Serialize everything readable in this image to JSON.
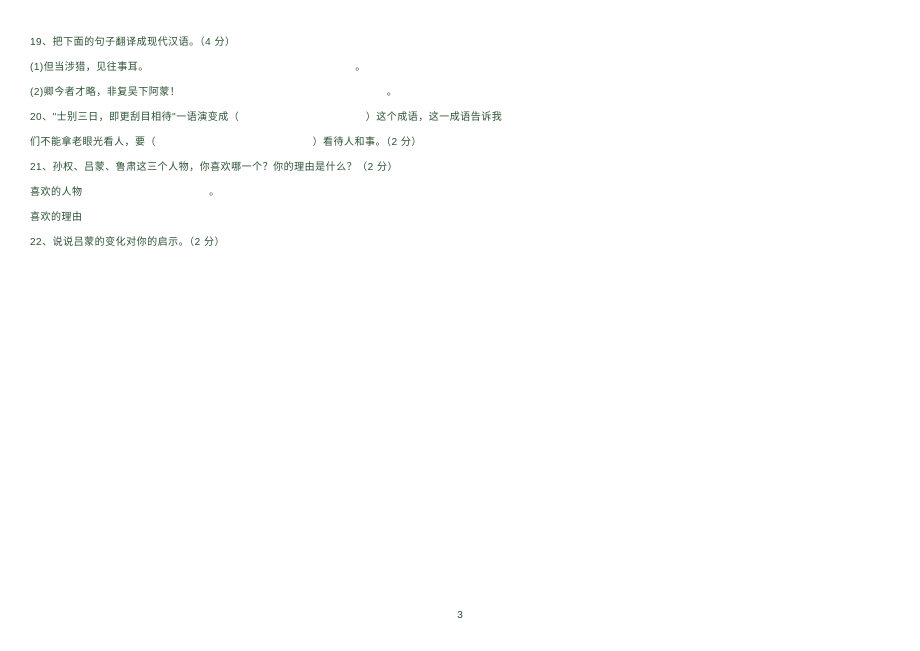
{
  "q19": {
    "prompt": "19、把下面的句子翻译成现代汉语。（4 分）",
    "items": [
      {
        "label": "(1)但当涉猎，见往事耳。",
        "terminator": "。"
      },
      {
        "label": "(2)卿今者才略，非复吴下阿蒙！",
        "terminator": "。"
      }
    ]
  },
  "q20": {
    "part1": "20、\"士别三日，即更刮目相待\"一语演变成（",
    "part2": "）这个成语，这一成语告诉我",
    "part3": "们不能拿老眼光看人，要（",
    "part4": "）看待人和事。（2 分）"
  },
  "q21": {
    "prompt": "21、孙权、吕蒙、鲁肃这三个人物，你喜欢哪一个？你的理由是什么？（2 分）",
    "person_label": "喜欢的人物",
    "person_terminator": "。",
    "reason_label": "喜欢的理由"
  },
  "q22": {
    "prompt": "22、说说吕蒙的变化对你的启示。（2 分）"
  },
  "page_number": "3"
}
